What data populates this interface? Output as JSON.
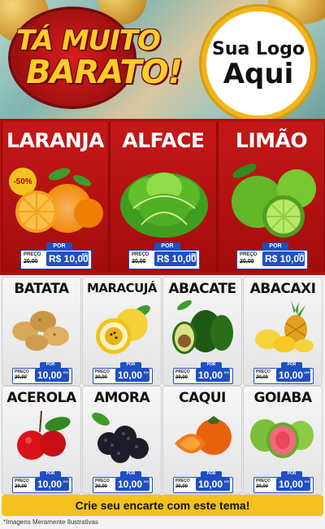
{
  "header": {
    "title_line1": "TÁ MUITO",
    "title_line2": "BARATO!",
    "logo_line1": "Sua Logo",
    "logo_line2": "Aqui"
  },
  "featured": [
    {
      "name": "LARANJA",
      "badge": "-50%",
      "price_label": "PREÇO",
      "old_price": "20,00",
      "por_label": "POR",
      "new_price": "R$ 10,00",
      "unit": "KG"
    },
    {
      "name": "ALFACE",
      "price_label": "PREÇO",
      "old_price": "20,00",
      "por_label": "POR",
      "new_price": "R$ 10,00",
      "unit": "UNI"
    },
    {
      "name": "LIMÃO",
      "price_label": "PREÇO",
      "old_price": "20,00",
      "por_label": "POR",
      "new_price": "R$ 10,00",
      "unit": "KG"
    }
  ],
  "products": [
    {
      "name": "BATATA",
      "price_label": "PREÇO",
      "old_price": "20,00",
      "por_label": "POR",
      "new_price": "10,00",
      "unit": "KG"
    },
    {
      "name": "MARACUJÁ",
      "price_label": "PREÇO",
      "old_price": "20,00",
      "por_label": "POR",
      "new_price": "10,00",
      "unit": "KG"
    },
    {
      "name": "ABACATE",
      "price_label": "PREÇO",
      "old_price": "20,00",
      "por_label": "POR",
      "new_price": "10,00",
      "unit": "KG"
    },
    {
      "name": "ABACAXI",
      "price_label": "PREÇO",
      "old_price": "20,00",
      "por_label": "POR",
      "new_price": "10,00",
      "unit": "UNI"
    },
    {
      "name": "ACEROLA",
      "price_label": "PREÇO",
      "old_price": "20,00",
      "por_label": "POR",
      "new_price": "10,00",
      "unit": "KG"
    },
    {
      "name": "AMORA",
      "price_label": "PREÇO",
      "old_price": "20,00",
      "por_label": "POR",
      "new_price": "10,00",
      "unit": "KG"
    },
    {
      "name": "CAQUI",
      "price_label": "PREÇO",
      "old_price": "20,00",
      "por_label": "POR",
      "new_price": "10,00",
      "unit": "KG"
    },
    {
      "name": "GOIABA",
      "price_label": "PREÇO",
      "old_price": "20,00",
      "por_label": "POR",
      "new_price": "10,00",
      "unit": "KG"
    }
  ],
  "footer": {
    "cta": "Crie seu encarte com este tema!",
    "disclaimer": "*Imagens Meramente Ilustrativas"
  },
  "colors": {
    "brand_red": "#b40f0f",
    "price_blue": "#1f4fc2",
    "accent_yellow": "#f5c11c"
  }
}
